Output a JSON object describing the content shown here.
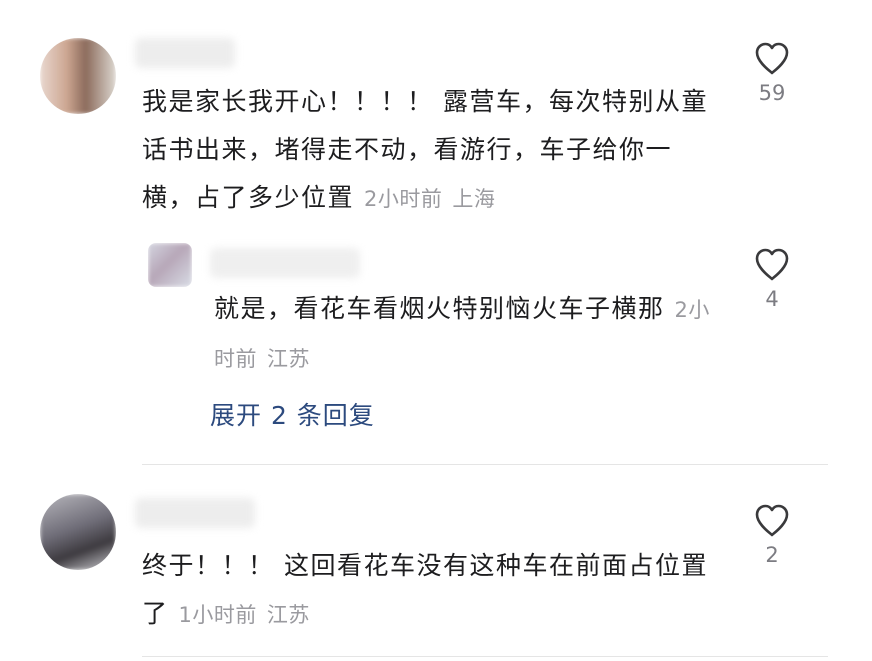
{
  "comments": [
    {
      "text": "我是家长我开心！！！！ 露营车，每次特别从童话书出来，堵得走不动，看游行，车子给你一横，占了多少位置",
      "time": "2小时前",
      "location": "上海",
      "likes": "59",
      "reply": {
        "text": "就是，看花车看烟火特别恼火车子横那",
        "time": "2小时前",
        "location": "江苏",
        "likes": "4"
      },
      "expand_label": "展开 2 条回复"
    },
    {
      "text": "终于！！！ 这回看花车没有这种车在前面占位置了",
      "time": "1小时前",
      "location": "江苏",
      "likes": "2"
    }
  ],
  "icons": {
    "like": "heart-outline-icon"
  },
  "colors": {
    "text": "#1d1d1f",
    "meta": "#9a9a9f",
    "link": "#2c4a7e",
    "divider": "#e5e5e5"
  }
}
